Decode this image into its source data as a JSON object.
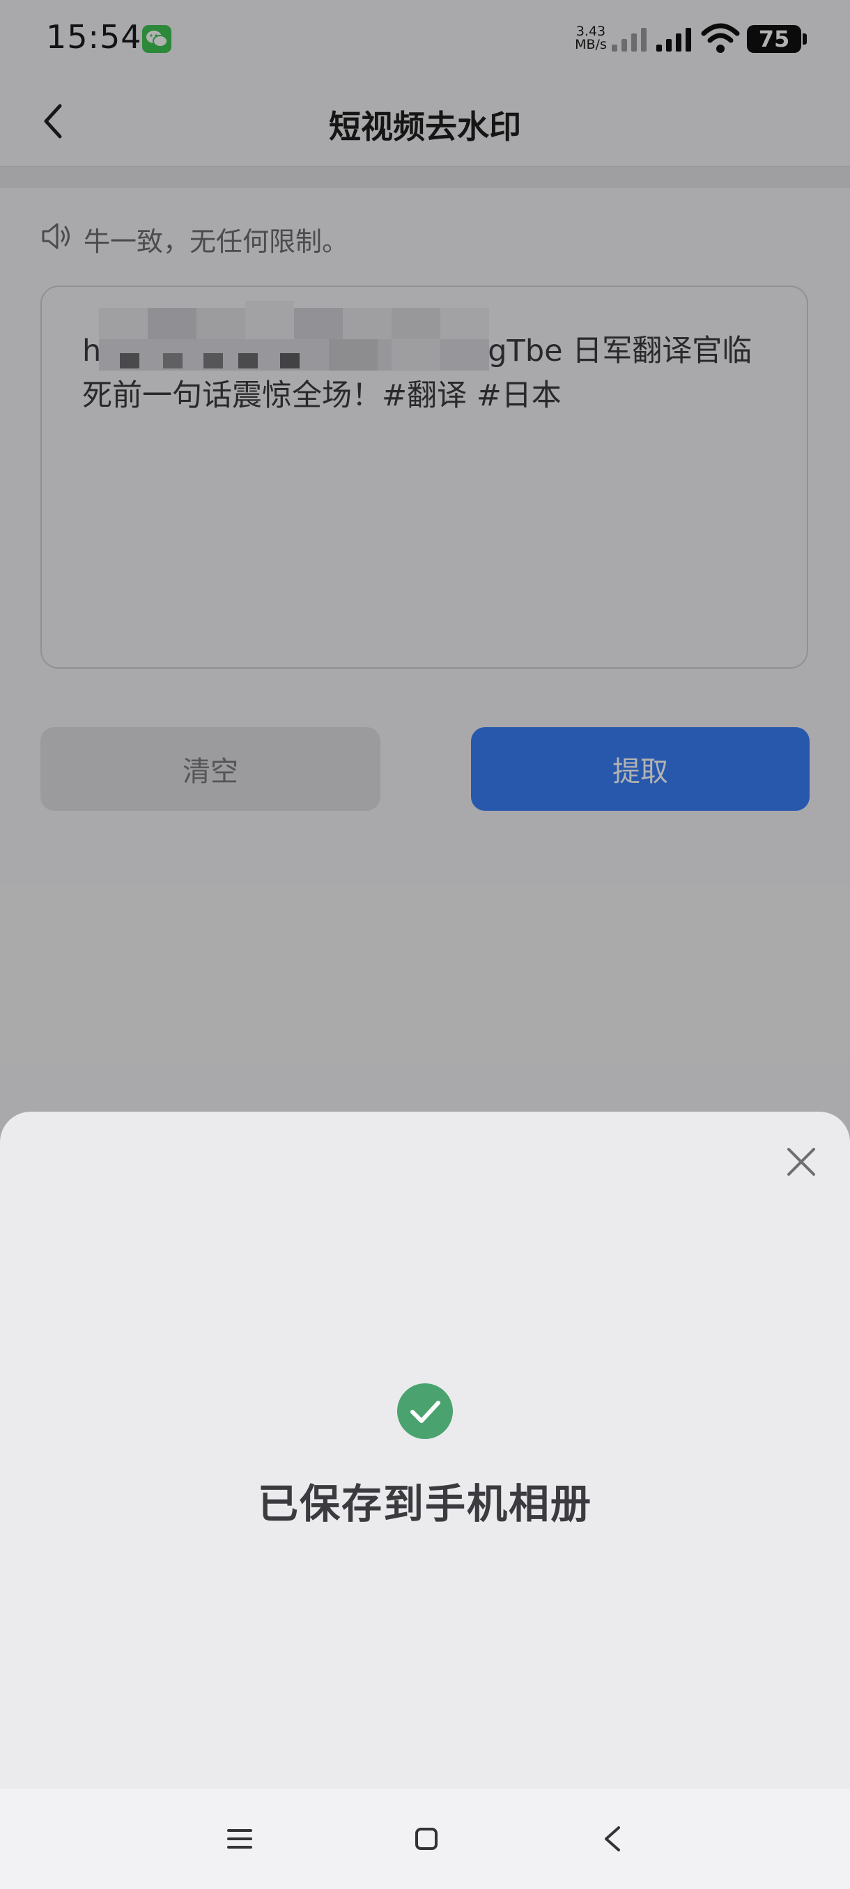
{
  "status_bar": {
    "time": "15:54",
    "net_speed_value": "3.43",
    "net_speed_unit": "MB/s",
    "battery_level": "75",
    "notification_icon": "wechat-icon"
  },
  "header": {
    "title": "短视频去水印",
    "back_icon": "chevron-left-icon"
  },
  "notice": {
    "icon": "speaker-icon",
    "text": "牛一致，无任何限制。"
  },
  "input": {
    "text_prefix": "h",
    "text_visible": "gTbe 日军翻译官临死前一句话震惊全场！#翻译 #日本"
  },
  "actions": {
    "clear_label": "清空",
    "extract_label": "提取"
  },
  "sheet": {
    "close_icon": "close-icon",
    "success_icon": "check-circle-icon",
    "message": "已保存到手机相册"
  },
  "colors": {
    "primary": "#3a7ef6",
    "success": "#4aa36e",
    "background": "#f3f3f5",
    "sheet_background": "#ebebee"
  },
  "system_nav": {
    "menu_icon": "menu-icon",
    "home_icon": "home-icon",
    "back_icon": "back-icon"
  }
}
